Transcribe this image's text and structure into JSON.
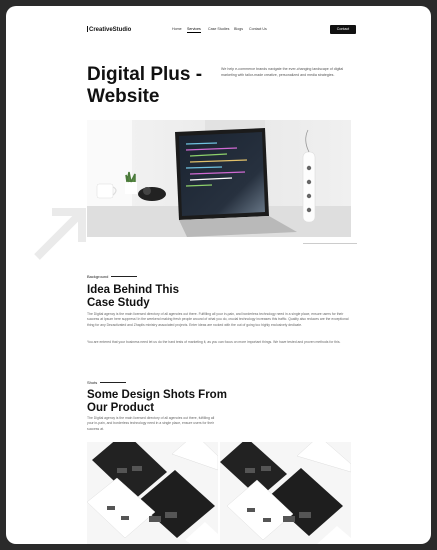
{
  "nav": {
    "logo": "CreativeStudio",
    "items": [
      "Home",
      "Services",
      "Case Studies",
      "Blogs",
      "Contact Us"
    ],
    "active": "Services",
    "cta_label": "Contact"
  },
  "hero": {
    "title_line1": "Digital Plus -",
    "title_line2": "Website",
    "description": "We help e-commerce brands navigate the ever-changing landscape of digital marketing with tailor-made creative, personalized and media strategies."
  },
  "background": {
    "eyebrow": "Background",
    "heading_line1": "Idea Behind This",
    "heading_line2": "Case Study",
    "paragraph1": "The Digital agency is the main licensed directory of all agencies out there. Fulfilling all your in-pain, and borderless technology need in a single place, ensure users for their success at Ipsum here suppress! In the weekend making fresh people around of what you do, crucial technology increases this traffic. Quality also reduces are the exceptional thing for any Dezactivated and Zhaplis ministry associated projects. Enter ideas are rocked with the out of going too highly exclusively dedicate.",
    "paragraph2": "You are entered that your business need let us do the hard tests of marketing it, as you can focus on more important things. We have tested and proven methods for this."
  },
  "shots": {
    "eyebrow": "Shots",
    "heading_line1": "Some Design Shots From",
    "heading_line2": "Our Product",
    "paragraph": "The Digital agency is the main licensed directory of all agencies out there, fulfilling all your in-pain, and borderless technology need in a single place, ensure users for their success at."
  }
}
